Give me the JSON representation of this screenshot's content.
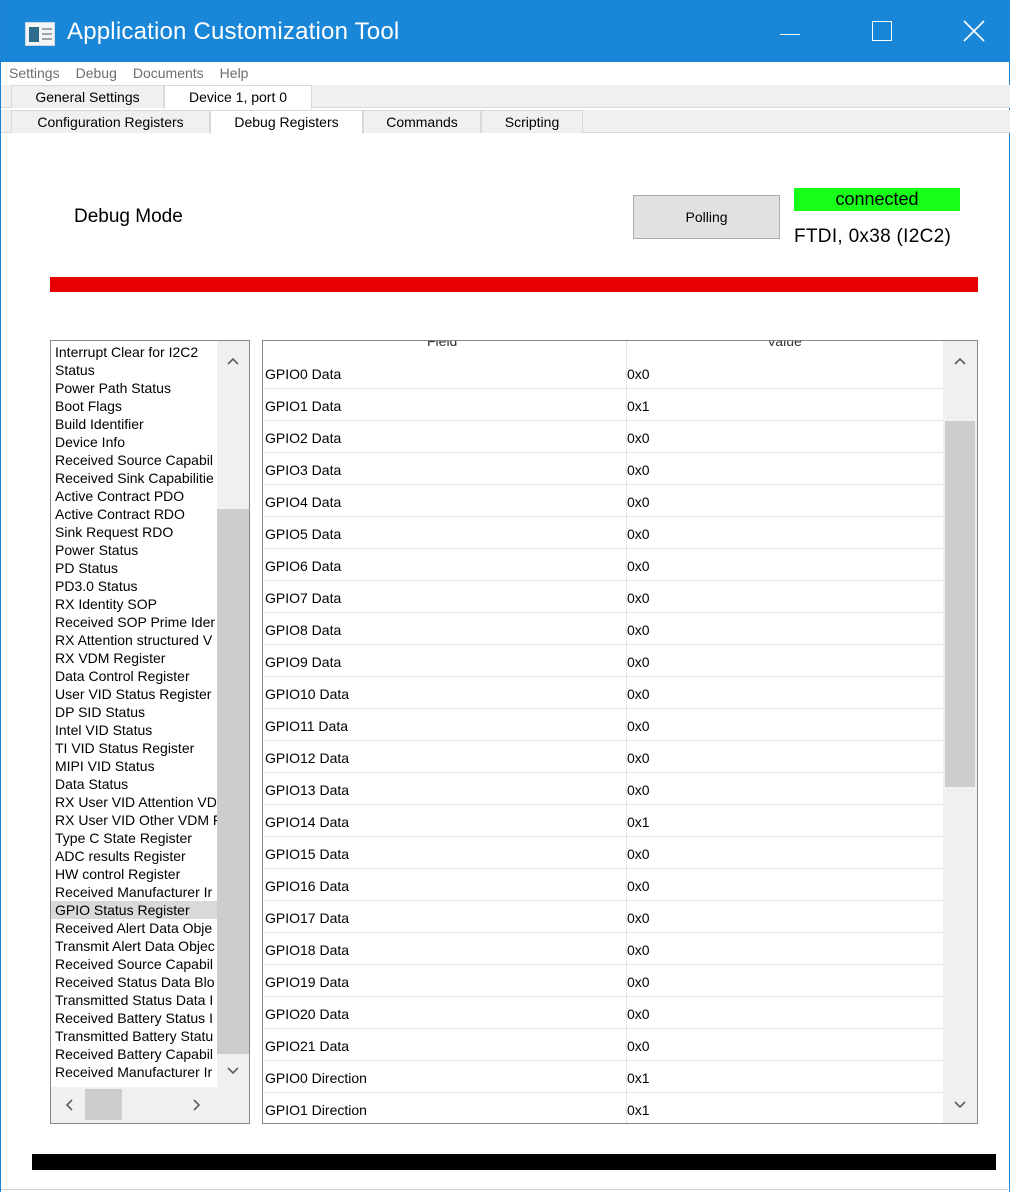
{
  "window": {
    "title": "Application Customization Tool",
    "title_bar_color": "#1a86d8"
  },
  "menu": [
    "Settings",
    "Debug",
    "Documents",
    "Help"
  ],
  "outer_tabs": [
    "General Settings",
    "Device 1, port 0"
  ],
  "inner_tabs": [
    "Configuration Registers",
    "Debug Registers",
    "Commands",
    "Scripting"
  ],
  "main": {
    "heading": "Debug Mode",
    "polling_button": "Polling",
    "status": "connected",
    "status_color": "#17ff17",
    "connection": "FTDI, 0x38 (I2C2)",
    "status_bar_color": "#e60000"
  },
  "register_list": {
    "items": [
      "Interrupt Clear for I2C2",
      "Status",
      "Power Path Status",
      "Boot Flags",
      "Build Identifier",
      "Device Info",
      "Received Source Capabil",
      "Received Sink Capabilitie",
      "Active Contract PDO",
      "Active Contract RDO",
      "Sink Request RDO",
      "Power Status",
      "PD Status",
      "PD3.0 Status",
      "RX Identity SOP",
      "Received SOP Prime Ider",
      "RX Attention structured V",
      "RX VDM Register",
      "Data Control Register",
      "User VID Status Register",
      "DP SID Status",
      "Intel VID Status",
      "TI VID Status Register",
      "MIPI VID Status",
      "Data Status",
      "RX User VID Attention VD",
      "RX User VID Other VDM F",
      "Type C State Register",
      "ADC results Register",
      "HW control Register",
      "Received Manufacturer Ir",
      "GPIO Status Register",
      "Received Alert Data Obje",
      "Transmit Alert Data Objec",
      "Received Source Capabil",
      "Received Status Data Blo",
      "Transmitted Status Data I",
      "Received Battery Status I",
      "Transmitted Battery Statu",
      "Received Battery Capabil",
      "Received Manufacturer Ir"
    ],
    "selected": "GPIO Status Register"
  },
  "register_table": {
    "columns": [
      "Field",
      "Value"
    ],
    "rows": [
      [
        "GPIO0 Data",
        "0x0"
      ],
      [
        "GPIO1 Data",
        "0x1"
      ],
      [
        "GPIO2 Data",
        "0x0"
      ],
      [
        "GPIO3 Data",
        "0x0"
      ],
      [
        "GPIO4 Data",
        "0x0"
      ],
      [
        "GPIO5 Data",
        "0x0"
      ],
      [
        "GPIO6 Data",
        "0x0"
      ],
      [
        "GPIO7 Data",
        "0x0"
      ],
      [
        "GPIO8 Data",
        "0x0"
      ],
      [
        "GPIO9 Data",
        "0x0"
      ],
      [
        "GPIO10 Data",
        "0x0"
      ],
      [
        "GPIO11 Data",
        "0x0"
      ],
      [
        "GPIO12 Data",
        "0x0"
      ],
      [
        "GPIO13 Data",
        "0x0"
      ],
      [
        "GPIO14 Data",
        "0x1"
      ],
      [
        "GPIO15 Data",
        "0x0"
      ],
      [
        "GPIO16 Data",
        "0x0"
      ],
      [
        "GPIO17 Data",
        "0x0"
      ],
      [
        "GPIO18 Data",
        "0x0"
      ],
      [
        "GPIO19 Data",
        "0x0"
      ],
      [
        "GPIO20 Data",
        "0x0"
      ],
      [
        "GPIO21 Data",
        "0x0"
      ],
      [
        "GPIO0 Direction",
        "0x1"
      ],
      [
        "GPIO1 Direction",
        "0x1"
      ]
    ]
  },
  "icons": {
    "app": "app-icon",
    "minimize": "minimize-icon",
    "maximize": "maximize-icon",
    "close": "close-icon"
  }
}
